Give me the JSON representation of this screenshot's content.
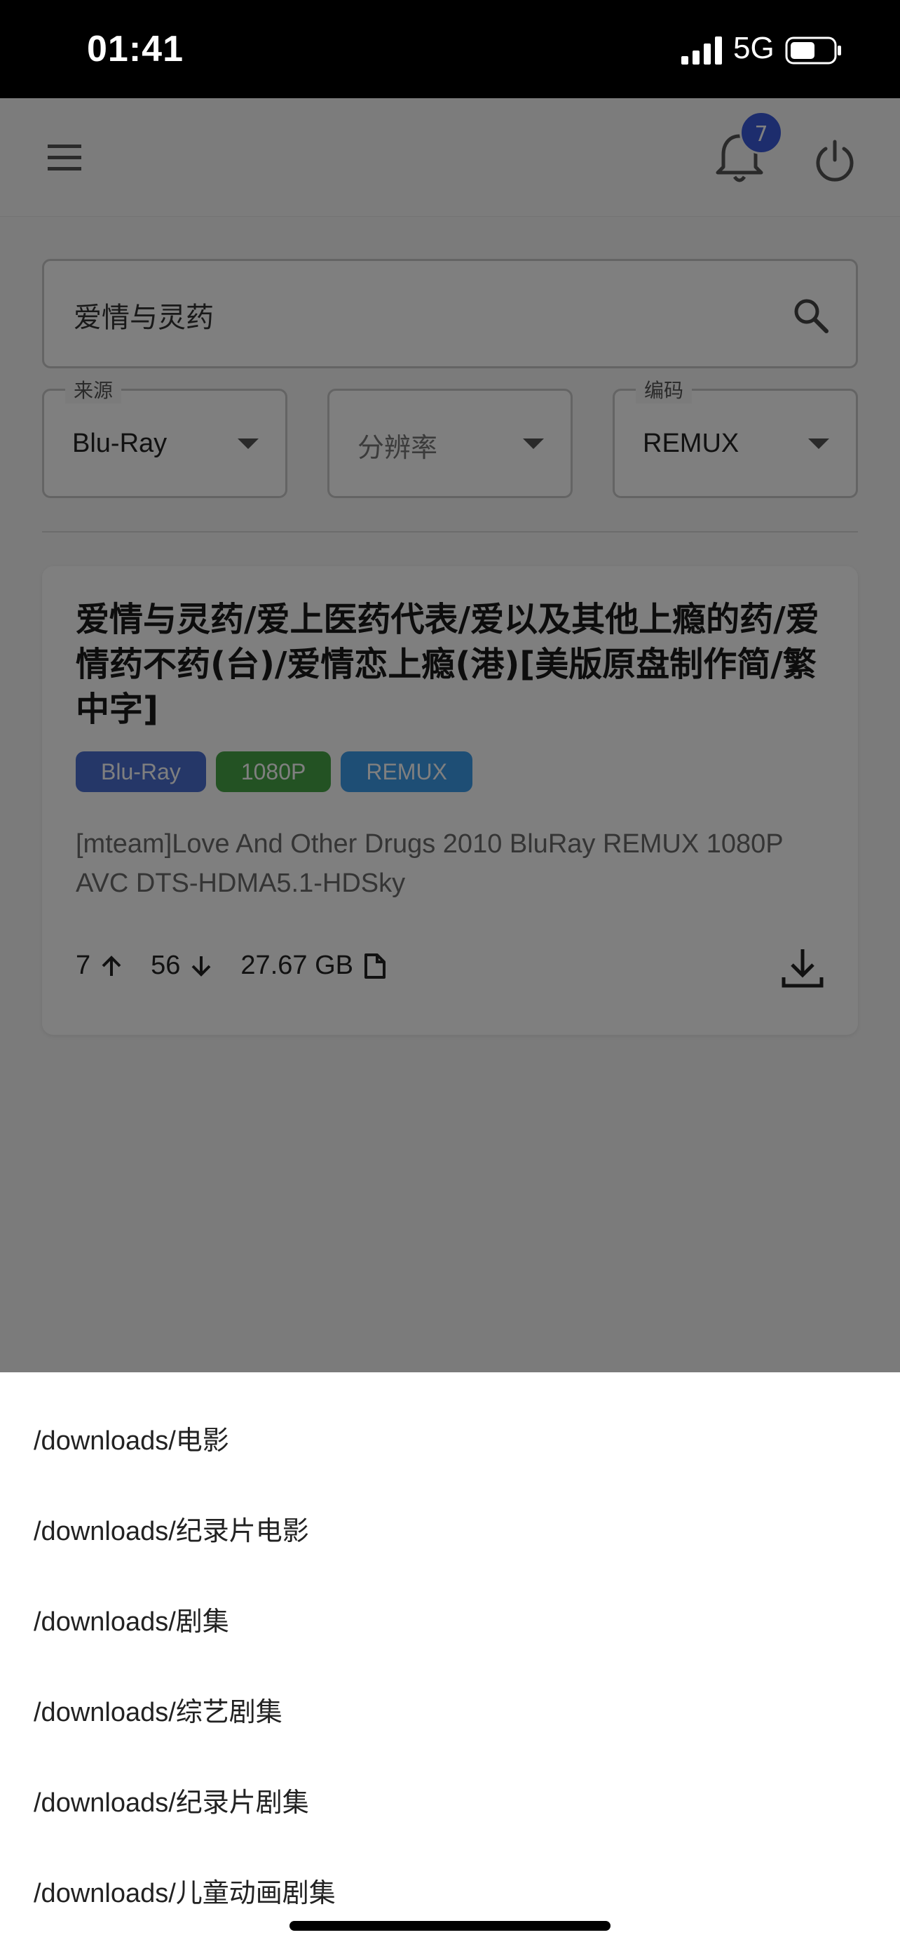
{
  "status_bar": {
    "time": "01:41",
    "network": "5G"
  },
  "app_bar": {
    "notification_count": "7"
  },
  "search": {
    "query": "爱情与灵药"
  },
  "filters": [
    {
      "legend": "来源",
      "value": "Blu-Ray",
      "placeholder": ""
    },
    {
      "legend": "",
      "value": "",
      "placeholder": "分辨率"
    },
    {
      "legend": "编码",
      "value": "REMUX",
      "placeholder": ""
    }
  ],
  "result": {
    "title": "爱情与灵药/爱上医药代表/爱以及其他上瘾的药/爱情药不药(台)/爱情恋上瘾(港)[美版原盘制作简/繁中字]",
    "tags": [
      {
        "label": "Blu-Ray",
        "color": "#4a6fd1"
      },
      {
        "label": "1080P",
        "color": "#47a447"
      },
      {
        "label": "REMUX",
        "color": "#3c9cea"
      }
    ],
    "subtitle": "[mteam]Love And Other Drugs 2010 BluRay REMUX 1080P AVC DTS-HDMA5.1-HDSky",
    "seeders": "7",
    "leechers": "56",
    "size": "27.67 GB"
  },
  "download_paths": [
    "/downloads/电影",
    "/downloads/纪录片电影",
    "/downloads/剧集",
    "/downloads/综艺剧集",
    "/downloads/纪录片剧集",
    "/downloads/儿童动画剧集"
  ],
  "icons": [
    "menu-icon",
    "bell-icon",
    "power-icon",
    "search-icon",
    "arrow-up-icon",
    "arrow-down-icon",
    "file-icon",
    "download-icon"
  ]
}
